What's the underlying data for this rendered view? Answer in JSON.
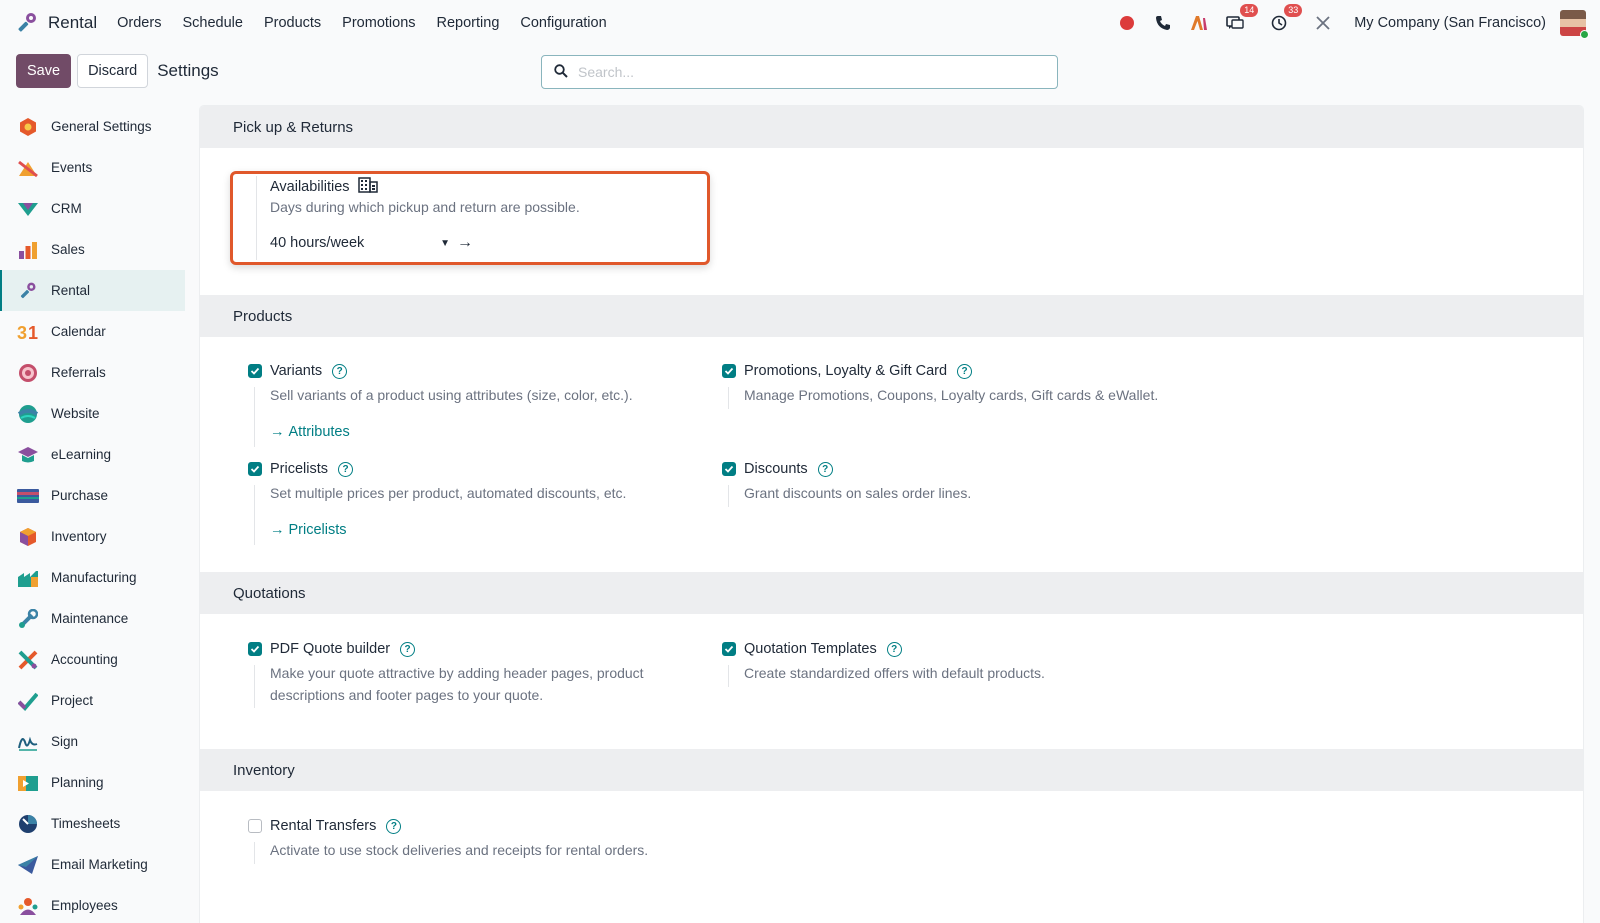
{
  "navbar": {
    "app_name": "Rental",
    "menu": [
      "Orders",
      "Schedule",
      "Products",
      "Promotions",
      "Reporting",
      "Configuration"
    ],
    "messages_badge": "14",
    "activities_badge": "33",
    "company": "My Company (San Francisco)"
  },
  "control": {
    "save_label": "Save",
    "discard_label": "Discard",
    "title": "Settings",
    "search_placeholder": "Search..."
  },
  "sidebar": {
    "items": [
      {
        "label": "General Settings",
        "icon": "general-settings-icon"
      },
      {
        "label": "Events",
        "icon": "events-icon"
      },
      {
        "label": "CRM",
        "icon": "crm-icon"
      },
      {
        "label": "Sales",
        "icon": "sales-icon"
      },
      {
        "label": "Rental",
        "icon": "rental-icon"
      },
      {
        "label": "Calendar",
        "icon": "calendar-icon"
      },
      {
        "label": "Referrals",
        "icon": "referrals-icon"
      },
      {
        "label": "Website",
        "icon": "website-icon"
      },
      {
        "label": "eLearning",
        "icon": "elearning-icon"
      },
      {
        "label": "Purchase",
        "icon": "purchase-icon"
      },
      {
        "label": "Inventory",
        "icon": "inventory-icon"
      },
      {
        "label": "Manufacturing",
        "icon": "manufacturing-icon"
      },
      {
        "label": "Maintenance",
        "icon": "maintenance-icon"
      },
      {
        "label": "Accounting",
        "icon": "accounting-icon"
      },
      {
        "label": "Project",
        "icon": "project-icon"
      },
      {
        "label": "Sign",
        "icon": "sign-icon"
      },
      {
        "label": "Planning",
        "icon": "planning-icon"
      },
      {
        "label": "Timesheets",
        "icon": "timesheets-icon"
      },
      {
        "label": "Email Marketing",
        "icon": "email-marketing-icon"
      },
      {
        "label": "Employees",
        "icon": "employees-icon"
      }
    ],
    "active": "Rental"
  },
  "sections": {
    "pickup": {
      "header": "Pick up & Returns",
      "availabilities": {
        "title": "Availabilities",
        "desc": "Days during which pickup and return are possible.",
        "value": "40 hours/week"
      }
    },
    "products": {
      "header": "Products",
      "variants": {
        "title": "Variants",
        "desc": "Sell variants of a product using attributes (size, color, etc.).",
        "link": "Attributes",
        "checked": true
      },
      "promotions": {
        "title": "Promotions, Loyalty & Gift Card",
        "desc": "Manage Promotions, Coupons, Loyalty cards, Gift cards & eWallet.",
        "checked": true
      },
      "pricelists": {
        "title": "Pricelists",
        "desc": "Set multiple prices per product, automated discounts, etc.",
        "link": "Pricelists",
        "checked": true
      },
      "discounts": {
        "title": "Discounts",
        "desc": "Grant discounts on sales order lines.",
        "checked": true
      }
    },
    "quotations": {
      "header": "Quotations",
      "pdf_builder": {
        "title": "PDF Quote builder",
        "desc_line1": "Make your quote attractive by adding header pages, product",
        "desc_line2": "descriptions and footer pages to your quote.",
        "checked": true
      },
      "templates": {
        "title": "Quotation Templates",
        "desc": "Create standardized offers with default products.",
        "checked": true
      }
    },
    "inventory": {
      "header": "Inventory",
      "rental_transfers": {
        "title": "Rental Transfers",
        "desc": "Activate to use stock deliveries and receipts for rental orders.",
        "checked": false
      }
    }
  },
  "colors": {
    "primary": "#714b67",
    "accent": "#017e84",
    "highlight": "#e0582b",
    "badge": "#e04f4f"
  }
}
